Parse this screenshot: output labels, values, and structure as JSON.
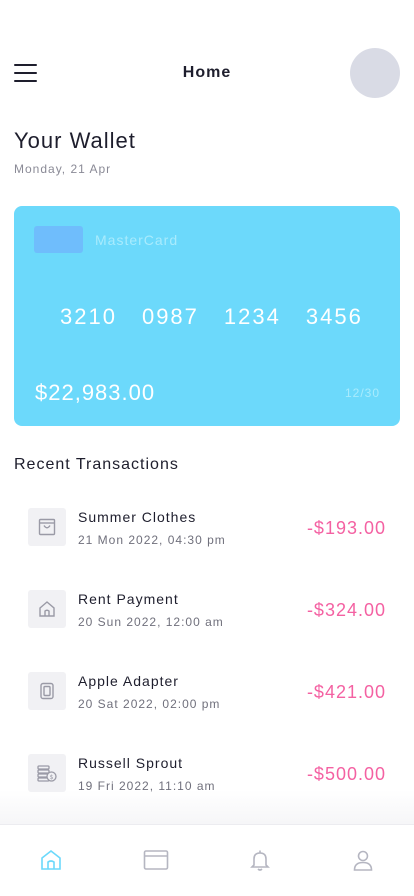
{
  "header": {
    "title": "Home"
  },
  "wallet": {
    "title": "Your Wallet",
    "date": "Monday, 21 Apr"
  },
  "card": {
    "brand": "MasterCard",
    "number_groups": [
      "3210",
      "0987",
      "1234",
      "3456"
    ],
    "balance": "$22,983.00",
    "expiry": "12/30"
  },
  "transactions": {
    "title": "Recent Transactions",
    "items": [
      {
        "name": "Summer Clothes",
        "time": "21 Mon 2022, 04:30 pm",
        "amount": "-$193.00",
        "icon": "shopping-bag-icon"
      },
      {
        "name": "Rent Payment",
        "time": "20 Sun 2022, 12:00 am",
        "amount": "-$324.00",
        "icon": "house-icon"
      },
      {
        "name": "Apple Adapter",
        "time": "20 Sat 2022, 02:00 pm",
        "amount": "-$421.00",
        "icon": "device-icon"
      },
      {
        "name": "Russell Sprout",
        "time": "19 Fri 2022, 11:10 am",
        "amount": "-$500.00",
        "icon": "coins-icon"
      }
    ]
  },
  "tabbar": {
    "tabs": [
      {
        "name": "home",
        "icon": "home-icon",
        "active": true
      },
      {
        "name": "cards",
        "icon": "card-icon",
        "active": false
      },
      {
        "name": "notifications",
        "icon": "bell-icon",
        "active": false
      },
      {
        "name": "profile",
        "icon": "user-icon",
        "active": false
      }
    ]
  },
  "colors": {
    "card_background": "#6cd9fb",
    "amount_negative": "#f461a2",
    "active_tab": "#6cd9fb",
    "inactive_tab": "#b5b6c1"
  }
}
